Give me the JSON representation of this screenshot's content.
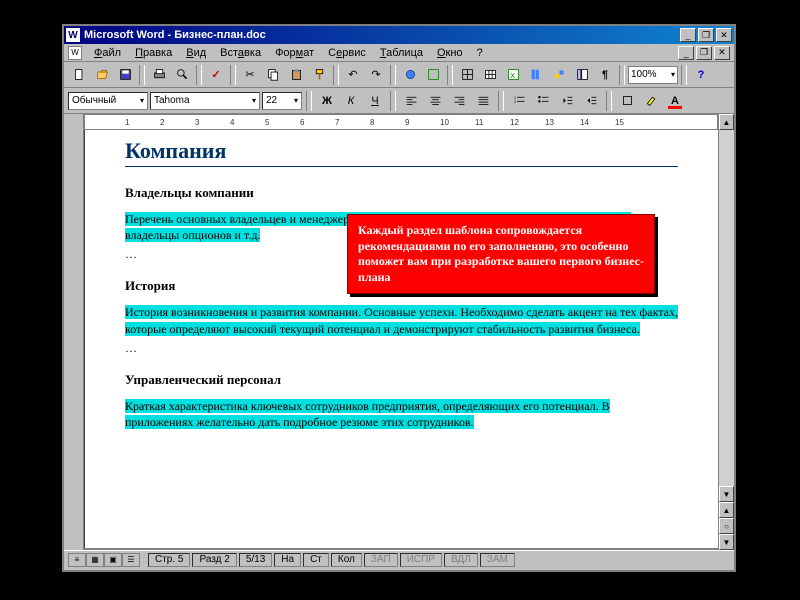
{
  "window": {
    "app": "Microsoft Word",
    "document": "Бизнес-план.doc",
    "title": "Microsoft Word - Бизнес-план.doc"
  },
  "menu": {
    "file": "Файл",
    "edit": "Правка",
    "view": "Вид",
    "insert": "Вставка",
    "format": "Формат",
    "tools": "Сервис",
    "table": "Таблица",
    "window": "Окно",
    "help": "?"
  },
  "toolbar": {
    "zoom": "100%"
  },
  "format": {
    "style": "Обычный",
    "font": "Tahoma",
    "size": "22"
  },
  "ruler_ticks": [
    "1",
    "2",
    "3",
    "4",
    "5",
    "6",
    "7",
    "8",
    "9",
    "10",
    "11",
    "12",
    "13",
    "14",
    "15"
  ],
  "doc": {
    "title": "Компания",
    "section1": {
      "heading": "Владельцы компании",
      "text": "Перечень основных владельцев и менеджеров. В перечень должны быть включены все акционеры, владельцы опционов и т.д.",
      "ellipsis": "…"
    },
    "section2": {
      "heading": "История",
      "text": "История возникновения и развития компании. Основные успехи. Необходимо сделать акцент на тех фактах, которые определяют высокий текущий потенциал и демонстрируют стабильность развития бизнеса.",
      "ellipsis": "…"
    },
    "section3": {
      "heading": "Управленческий персонал",
      "text": "Краткая характеристика ключевых сотрудников предприятия, определяющих его потенциал. В приложениях желательно дать подробное резюме этих сотрудников."
    }
  },
  "callout": {
    "text": "Каждый раздел шаблона сопровождается рекомендациями по его заполнению, это особенно поможет вам при разработке вашего первого бизнес-плана"
  },
  "status": {
    "page": "Стр. 5",
    "section": "Разд 2",
    "pages": "5/13",
    "at": "На",
    "line": "Ст",
    "col": "Кол",
    "rec": "ЗАП",
    "trk": "ИСПР",
    "ext": "ВДЛ",
    "ovr": "ЗАМ"
  }
}
